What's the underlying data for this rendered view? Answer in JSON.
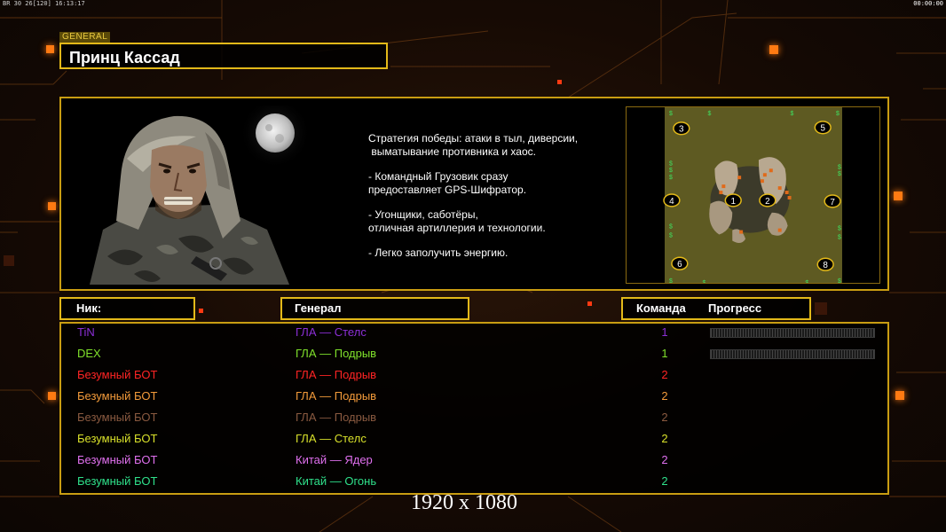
{
  "hud": {
    "left": "BR 30 26[120] 16:13:17",
    "right": "00:00:00"
  },
  "header": {
    "tag": "GENERAL",
    "title": "Принц Кассад"
  },
  "info": {
    "strategy_lines": [
      "Стратегия победы: атаки в тыл, диверсии,",
      " выматывание противника и хаос.",
      "",
      "- Командный Грузовик сразу",
      "предоставляет GPS-Шифратор.",
      "",
      "- Угонщики, саботёры,",
      "отличная артиллерия и технологии.",
      "",
      "- Легко заполучить энергию."
    ],
    "minimap": {
      "start_positions": [
        "1",
        "2",
        "3",
        "4",
        "5",
        "6",
        "7",
        "8"
      ],
      "resource_symbol": "$"
    }
  },
  "table": {
    "headers": {
      "nick": "Ник:",
      "general": "Генерал",
      "team": "Команда",
      "progress": "Прогресс"
    },
    "rows": [
      {
        "nick": "TiN",
        "general": "ГЛА — Стелс",
        "team": "1",
        "color": "#8c2fd6",
        "progress": 0.0
      },
      {
        "nick": "DEX",
        "general": "ГЛА — Подрыв",
        "team": "1",
        "color": "#7fe02b",
        "progress": 0.0
      },
      {
        "nick": "Безумный БОТ",
        "general": "ГЛА — Подрыв",
        "team": "2",
        "color": "#ff2424"
      },
      {
        "nick": "Безумный БОТ",
        "general": "ГЛА — Подрыв",
        "team": "2",
        "color": "#f29a3a"
      },
      {
        "nick": "Безумный БОТ",
        "general": "ГЛА — Подрыв",
        "team": "2",
        "color": "#8a5a40"
      },
      {
        "nick": "Безумный БОТ",
        "general": "ГЛА — Стелс",
        "team": "2",
        "color": "#d8e02a"
      },
      {
        "nick": "Безумный БОТ",
        "general": "Китай — Ядер",
        "team": "2",
        "color": "#e070ee"
      },
      {
        "nick": "Безумный БОТ",
        "general": "Китай — Огонь",
        "team": "2",
        "color": "#2fe08a"
      }
    ]
  },
  "footer": {
    "resolution": "1920 x 1080"
  },
  "colors": {
    "accent": "#e3b919",
    "panel_border": "#c99d12"
  }
}
